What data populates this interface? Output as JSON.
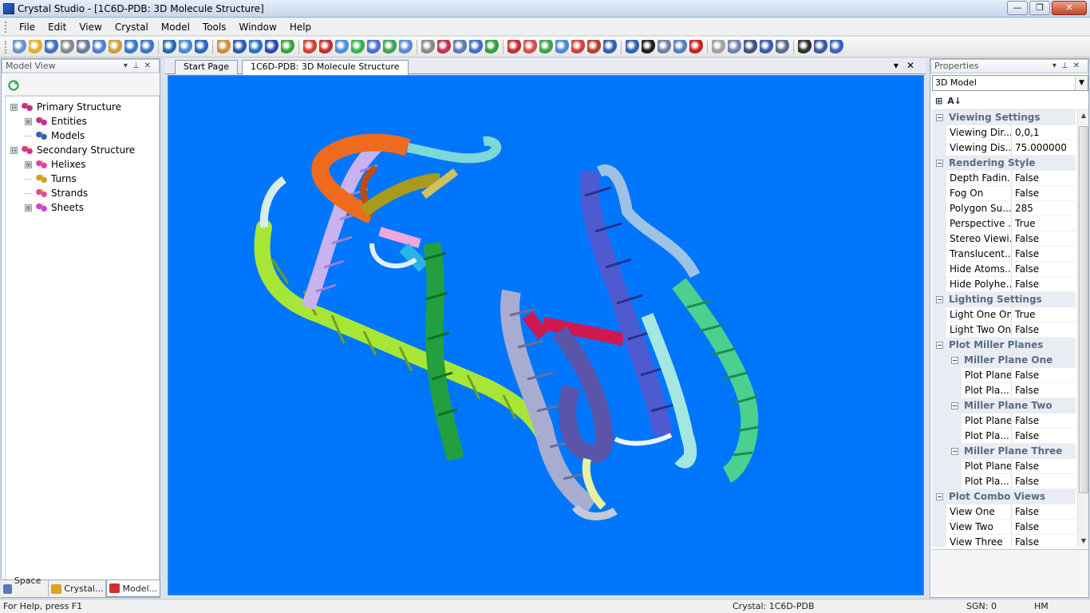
{
  "window": {
    "title": "Crystal Studio - [1C6D-PDB: 3D Molecule Structure]",
    "controls": {
      "minimize": "—",
      "maximize": "❐",
      "close": "✕"
    }
  },
  "menu": [
    "File",
    "Edit",
    "View",
    "Crystal",
    "Model",
    "Tools",
    "Window",
    "Help"
  ],
  "toolbar_icons": [
    "new-icon",
    "open-icon",
    "save-icon",
    "print-icon",
    "cut-icon",
    "copy-icon",
    "paste-icon",
    "undo-icon",
    "redo-icon",
    "axis-icon",
    "chart-icon",
    "refresh-icon",
    "pan-icon",
    "select-icon",
    "select-atoms-icon",
    "atom-label-icon",
    "build-icon",
    "bond-icon",
    "molecule-icon",
    "sphere-icon",
    "rotate-icon",
    "polyhedra-icon",
    "plane-icon",
    "grid-icon",
    "measure-icon",
    "lattice-icon",
    "symmetry-icon",
    "cell-icon",
    "cell-red-icon",
    "dots-icon",
    "dots-red-icon",
    "double-icon",
    "helix-icon",
    "dots-grid-icon",
    "box-icon",
    "globe-icon",
    "chart-bar-icon",
    "pattern-icon",
    "wireframe-icon",
    "formula-icon",
    "red-dot-icon",
    "small-dot-icon",
    "window-icon",
    "zoom-icon",
    "copy-view-icon",
    "export-icon",
    "film-icon",
    "text-icon",
    "help-icon"
  ],
  "left_panel": {
    "header": "Model View",
    "tree": [
      {
        "label": "Primary Structure",
        "level": 0,
        "expander": "⊟",
        "icon": "molecule-icon"
      },
      {
        "label": "Entities",
        "level": 1,
        "expander": "⊞",
        "icon": "entities-icon"
      },
      {
        "label": "Models",
        "level": 1,
        "expander": "",
        "icon": "models-icon"
      },
      {
        "label": "Secondary Structure",
        "level": 0,
        "expander": "⊟",
        "icon": "secondary-icon"
      },
      {
        "label": "Helixes",
        "level": 1,
        "expander": "⊞",
        "icon": "helix-icon"
      },
      {
        "label": "Turns",
        "level": 1,
        "expander": "",
        "icon": "turn-icon"
      },
      {
        "label": "Strands",
        "level": 1,
        "expander": "",
        "icon": "strand-icon"
      },
      {
        "label": "Sheets",
        "level": 1,
        "expander": "⊞",
        "icon": "sheet-icon"
      }
    ],
    "tabs": [
      {
        "label": "Space ...",
        "icon": "space-icon",
        "active": false
      },
      {
        "label": "Crystal...",
        "icon": "crystal-icon",
        "active": false
      },
      {
        "label": "Model...",
        "icon": "model-icon",
        "active": true
      }
    ]
  },
  "document_tabs": [
    {
      "label": "Start Page",
      "active": false
    },
    {
      "label": "1C6D-PDB: 3D Molecule Structure",
      "active": true
    }
  ],
  "viewport": {
    "background": "#0076fc"
  },
  "right_panel": {
    "header": "Properties",
    "selected_object": "3D Model",
    "rows": [
      {
        "type": "cat",
        "label": "Viewing Settings"
      },
      {
        "type": "prop",
        "name": "Viewing Dir...",
        "value": "0,0,1"
      },
      {
        "type": "prop",
        "name": "Viewing Dis...",
        "value": "75.000000"
      },
      {
        "type": "cat",
        "label": "Rendering Style"
      },
      {
        "type": "prop",
        "name": "Depth Fadin...",
        "value": "False"
      },
      {
        "type": "prop",
        "name": "Fog On",
        "value": "False"
      },
      {
        "type": "prop",
        "name": "Polygon Su...",
        "value": "285"
      },
      {
        "type": "prop",
        "name": "Perspective ...",
        "value": "True"
      },
      {
        "type": "prop",
        "name": "Stereo Viewi...",
        "value": "False"
      },
      {
        "type": "prop",
        "name": "Translucent...",
        "value": "False"
      },
      {
        "type": "prop",
        "name": "Hide Atoms...",
        "value": "False"
      },
      {
        "type": "prop",
        "name": "Hide Polyhe...",
        "value": "False"
      },
      {
        "type": "cat",
        "label": "Lighting Settings"
      },
      {
        "type": "prop",
        "name": "Light One On",
        "value": "True"
      },
      {
        "type": "prop",
        "name": "Light Two On",
        "value": "False"
      },
      {
        "type": "cat",
        "label": "Plot Miller Planes"
      },
      {
        "type": "sub",
        "label": "Miller Plane One"
      },
      {
        "type": "subprop",
        "name": "Plot Plane",
        "value": "False"
      },
      {
        "type": "subprop",
        "name": "Plot Pla...",
        "value": "False"
      },
      {
        "type": "sub",
        "label": "Miller Plane Two"
      },
      {
        "type": "subprop",
        "name": "Plot Plane",
        "value": "False"
      },
      {
        "type": "subprop",
        "name": "Plot Pla...",
        "value": "False"
      },
      {
        "type": "sub",
        "label": "Miller Plane Three"
      },
      {
        "type": "subprop",
        "name": "Plot Plane",
        "value": "False"
      },
      {
        "type": "subprop",
        "name": "Plot Pla...",
        "value": "False"
      },
      {
        "type": "cat",
        "label": "Plot Combo Views"
      },
      {
        "type": "prop",
        "name": "View One",
        "value": "False"
      },
      {
        "type": "prop",
        "name": "View Two",
        "value": "False"
      },
      {
        "type": "prop",
        "name": "View Three",
        "value": "False"
      }
    ]
  },
  "status": {
    "help": "For Help, press F1",
    "crystal": "Crystal:  1C6D-PDB",
    "sgn": "SGN: 0",
    "mode": "HM"
  }
}
